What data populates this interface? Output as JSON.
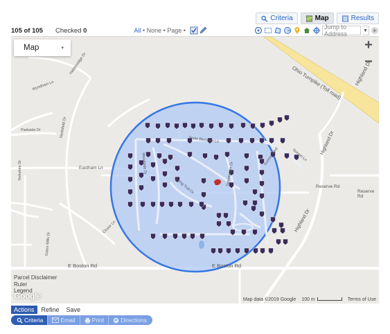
{
  "tabs": [
    {
      "label": "Criteria",
      "icon": "magnifier-icon",
      "active": false
    },
    {
      "label": "Map",
      "icon": "map-icon",
      "active": true
    },
    {
      "label": "Results",
      "icon": "list-icon",
      "active": false
    }
  ],
  "toolbar": {
    "count": "105 of 105",
    "checked_label": "Checked",
    "checked_value": "0",
    "select_all": "All",
    "select_none": "None",
    "select_page": "Page",
    "jump_placeholder": "Jump to Address"
  },
  "map": {
    "type_label": "Map",
    "zoom_in": "+",
    "zoom_out": "−",
    "roads": {
      "ohio_turnpike": "Ohio Turnpike (Toll road)",
      "highland_dr": "Highland Dr",
      "e_boston_rd_left": "E Boston Rd",
      "e_boston_rd_center": "E Boston Rd",
      "highland_dr_lower": "Highland Dr",
      "eastham_ln": "Eastham Ln",
      "reserve_rd": "Reserve Rd",
      "snow_blossom": "Snow Blossom Ln",
      "sunset_ln": "Sunset Ln",
      "spring_trail": "Spring Trail Dr",
      "sweetwater": "Sweetwater Dr",
      "sunrise_blvd": "Sunrise Blvd",
      "clover_ln": "Clover Ln",
      "wyndham_ln": "Wyndham Ln",
      "hiddenridge": "Hiddenridge Dr",
      "northfield": "Northfield Dr",
      "woodside": "Woodside Dr",
      "parkside": "Parkside Dr",
      "r_yorkshire": "Yorkshire Dr",
      "w_road": "Gates Mills Dr",
      "highland_dr_mid": "Highland Dr"
    },
    "legend": {
      "parcel": "Parcel Disclaimer",
      "ruler": "Ruler",
      "legend": "Legend"
    },
    "google": "Google",
    "attribution": "Map data ©2019 Google",
    "scale": "100 m",
    "terms": "Terms of Use",
    "colors": {
      "marker": "#3b2c5a",
      "selected_marker": "#c0302a",
      "circle_stroke": "#3476e6",
      "circle_fill": "#b6cdf3"
    }
  },
  "actions": [
    {
      "label": "Actions",
      "active": true
    },
    {
      "label": "Refine",
      "active": false
    },
    {
      "label": "Save",
      "active": false
    }
  ],
  "bottom_bar": [
    {
      "label": "Criteria",
      "icon": "magnifier-icon"
    },
    {
      "label": "Email",
      "icon": "envelope-icon"
    },
    {
      "label": "Print",
      "icon": "printer-icon"
    },
    {
      "label": "Directions",
      "icon": "directions-icon"
    }
  ]
}
